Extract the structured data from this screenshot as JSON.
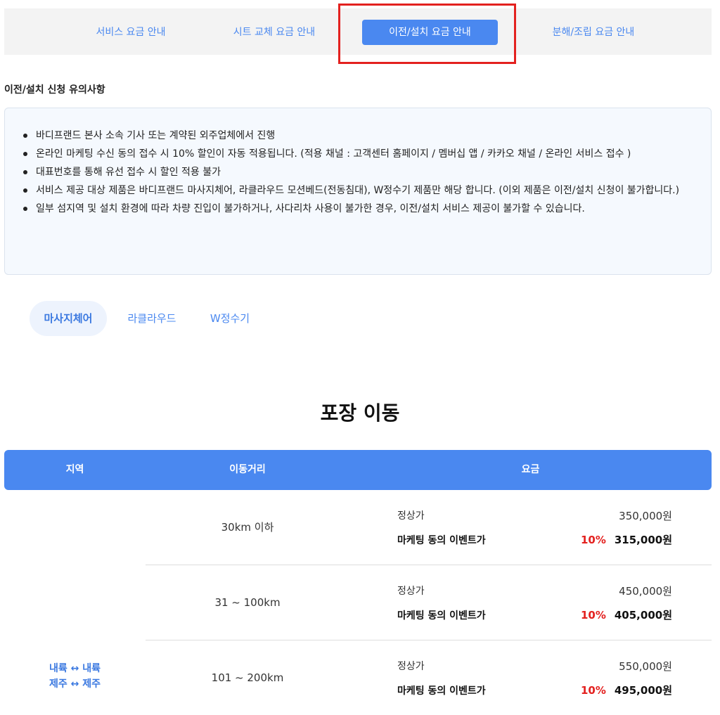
{
  "top_tabs": [
    {
      "label": "서비스 요금 안내",
      "active": false
    },
    {
      "label": "시트 교체 요금 안내",
      "active": false
    },
    {
      "label": "이전/설치 요금 안내",
      "active": true
    },
    {
      "label": "분해/조립 요금 안내",
      "active": false
    }
  ],
  "notice": {
    "title": "이전/설치 신청 유의사항",
    "items": [
      "바디프랜드 본사 소속 기사 또는 계약된 외주업체에서 진행",
      "온라인 마케팅 수신 동의 접수 시 10% 할인이 자동 적용됩니다. (적용 채널 : 고객센터 홈페이지 / 멤버십 앱 / 카카오 채널 / 온라인 서비스 접수 )",
      "대표번호를 통해 유선 접수 시 할인 적용 불가",
      "서비스 제공 대상 제품은 바디프랜드 마사지체어, 라클라우드 모션베드(전동침대), W정수기 제품만 해당 합니다. (이외 제품은 이전/설치 신청이 불가합니다.)",
      "일부 섬지역 및 설치 환경에 따라 차량 진입이 불가하거나, 사다리차 사용이 불가한 경우, 이전/설치 서비스 제공이 불가할 수 있습니다."
    ]
  },
  "product_tabs": [
    {
      "label": "마사지체어",
      "active": true
    },
    {
      "label": "라클라우드",
      "active": false
    },
    {
      "label": "W정수기",
      "active": false
    }
  ],
  "section": {
    "title": "포장 이동",
    "headers": {
      "region": "지역",
      "distance": "이동거리",
      "fee": "요금"
    },
    "region_label": [
      "내륙 ↔ 내륙",
      "제주 ↔ 제주"
    ],
    "normal_label": "정상가",
    "event_label": "마케팅 동의 이벤트가",
    "rows": [
      {
        "distance": "30km 이하",
        "normal_price": "350,000원",
        "discount": "10%",
        "event_price": "315,000원"
      },
      {
        "distance": "31 ~ 100km",
        "normal_price": "450,000원",
        "discount": "10%",
        "event_price": "405,000원"
      },
      {
        "distance": "101 ~ 200km",
        "normal_price": "550,000원",
        "discount": "10%",
        "event_price": "495,000원"
      }
    ]
  },
  "colors": {
    "accent": "#4a88f0",
    "discount": "#e3211f",
    "highlight": "#e3211f"
  }
}
